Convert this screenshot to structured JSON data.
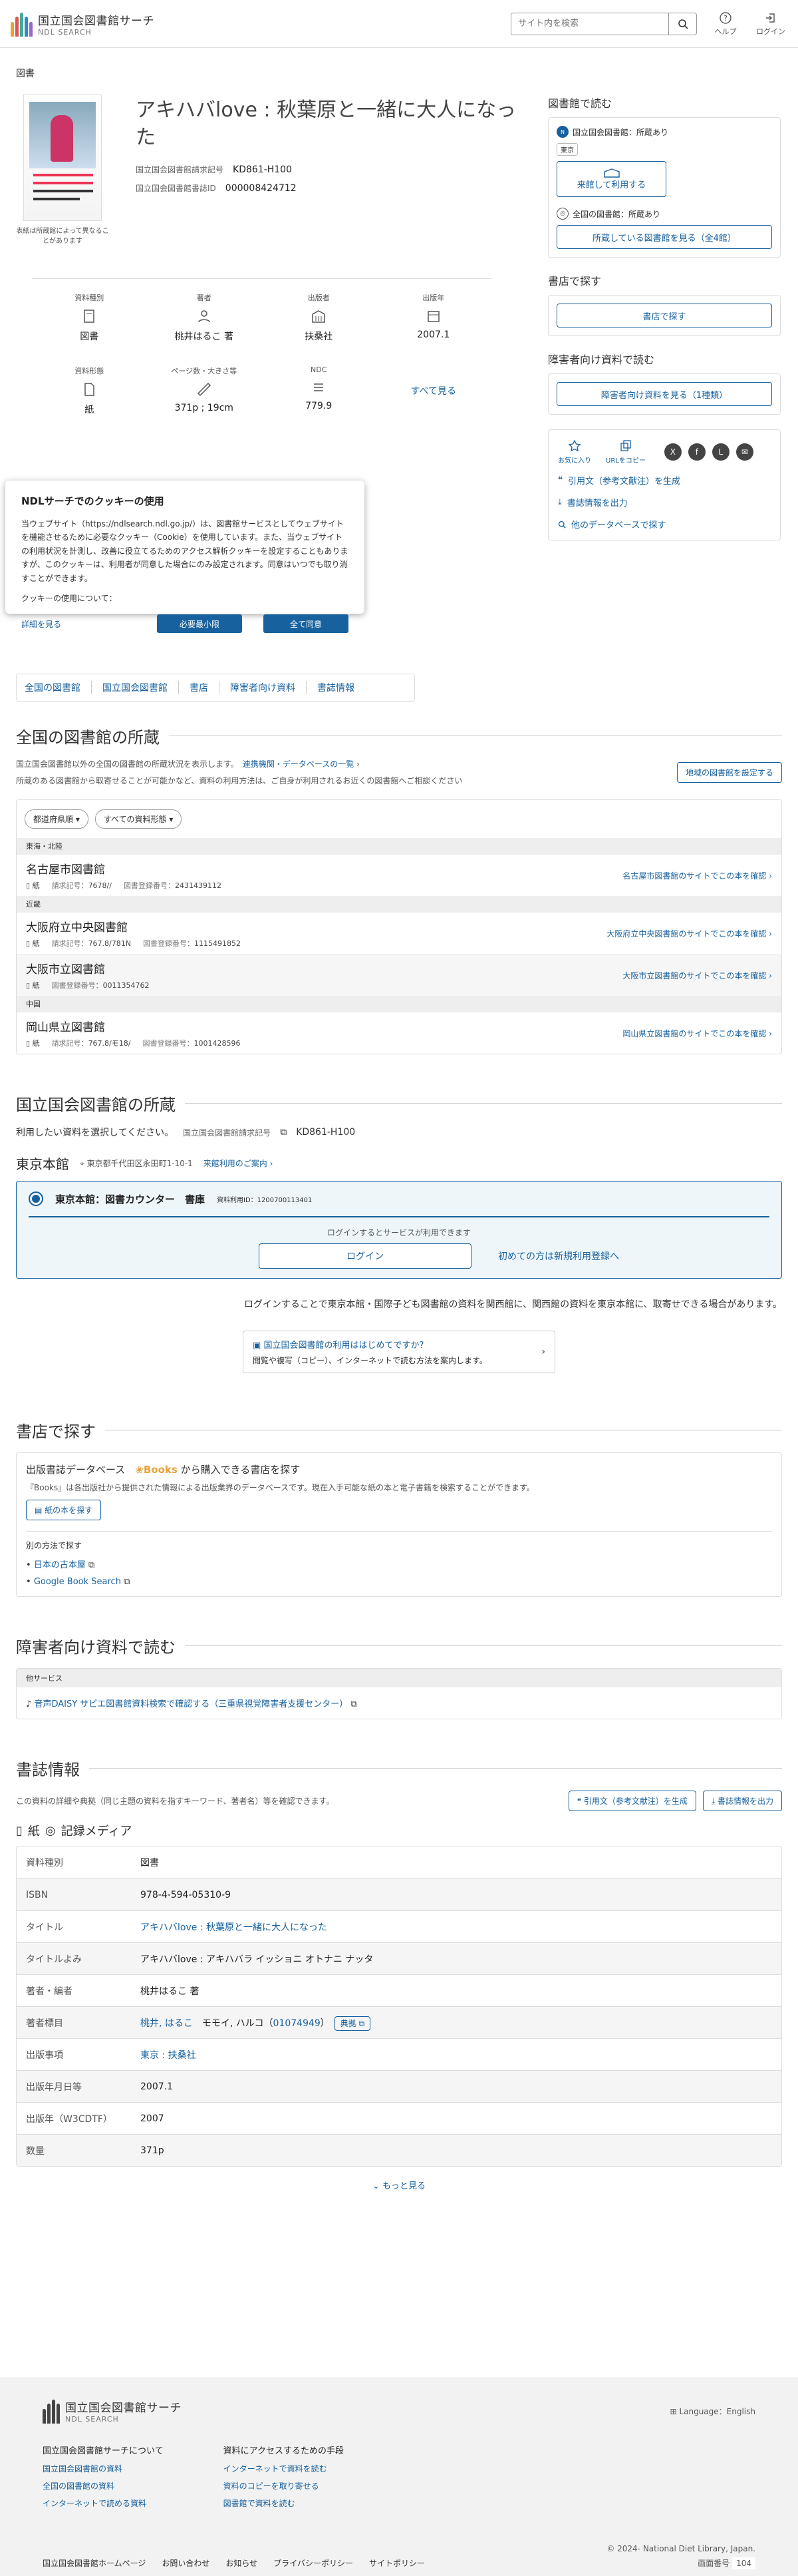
{
  "header": {
    "logo_main": "国立国会図書館サーチ",
    "logo_sub": "NDL SEARCH",
    "search_placeholder": "サイト内を検索",
    "help": "ヘルプ",
    "login": "ログイン"
  },
  "breadcrumb": "図書",
  "book": {
    "title": "アキハバlove : 秋葉原と一緒に大人になった",
    "call_label": "国立国会図書館請求記号",
    "call_value": "KD861-H100",
    "id_label": "国立国会図書館書誌ID",
    "id_value": "000008424712",
    "cover_note": "表紙は所蔵館によって異なることがあります"
  },
  "facts": [
    {
      "label": "資料種別",
      "value": "図書"
    },
    {
      "label": "著者",
      "value": "桃井はるこ 著"
    },
    {
      "label": "出版者",
      "value": "扶桑社"
    },
    {
      "label": "出版年",
      "value": "2007.1"
    },
    {
      "label": "資料形態",
      "value": "紙"
    },
    {
      "label": "ページ数・大きさ等",
      "value": "371p ; 19cm"
    },
    {
      "label": "NDC",
      "value": "779.9"
    }
  ],
  "see_all": "すべて見る",
  "right": {
    "read_title": "図書館で読む",
    "ndl_holding": "国立国会図書館：所蔵あり",
    "tokyo_tag": "東京",
    "visit_btn": "来館して利用する",
    "all_holding": "全国の図書館：所蔵あり",
    "all_btn": "所蔵している図書館を見る（全4館）",
    "store_title": "書店で探す",
    "store_btn": "書店で探す",
    "dis_title": "障害者向け資料で読む",
    "dis_btn": "障害者向け資料を見る（1種類）",
    "fav": "お気に入り",
    "url": "URLをコピー",
    "cite": "引用文（参考文献注）を生成",
    "export": "書誌情報を出力",
    "other_db": "他のデータベースで探す"
  },
  "cookie": {
    "title": "NDLサーチでのクッキーの使用",
    "body": "当ウェブサイト（https://ndlsearch.ndl.go.jp/）は、図書館サービスとしてウェブサイトを機能させるために必要なクッキー（Cookie）を使用しています。また、当ウェブサイトの利用状況を計測し、改善に役立てるためのアクセス解析クッキーを設定することもありますが、このクッキーは、利用者が同意した場合にのみ設定されます。同意はいつでも取り消すことができます。",
    "about": "クッキーの使用について：",
    "more": "詳細を見る",
    "min": "必要最小限",
    "all": "全て同意"
  },
  "anchors": [
    "全国の図書館",
    "国立国会図書館",
    "書店",
    "障害者向け資料",
    "書誌情報"
  ],
  "national": {
    "title": "全国の図書館の所蔵",
    "desc": "国立国会図書館以外の全国の図書館の所蔵状況を表示します。",
    "link": "連携機関・データベースの一覧",
    "desc2": "所蔵のある図書館から取寄せることが可能かなど、資料の利用方法は、ご自身が利用されるお近くの図書館へご相談ください",
    "region_btn": "地域の図書館を設定する",
    "filter1": "都道府県順",
    "filter2": "すべての資料形態",
    "rows": [
      {
        "region": "東海・北陸",
        "name": "名古屋市図書館",
        "form": "紙",
        "call_k": "請求記号：",
        "call_v": "7678//",
        "reg_k": "図書登録番号：",
        "reg_v": "2431439112",
        "link": "名古屋市図書館のサイトでこの本を確認"
      },
      {
        "region": "近畿",
        "name": "大阪府立中央図書館",
        "form": "紙",
        "call_k": "請求記号：",
        "call_v": "767.8/781N",
        "reg_k": "図書登録番号：",
        "reg_v": "1115491852",
        "link": "大阪府立中央図書館のサイトでこの本を確認"
      },
      {
        "region": "",
        "name": "大阪市立図書館",
        "form": "紙",
        "call_k": "",
        "call_v": "",
        "reg_k": "図書登録番号：",
        "reg_v": "0011354762",
        "link": "大阪市立図書館のサイトでこの本を確認"
      },
      {
        "region": "中国",
        "name": "岡山県立図書館",
        "form": "紙",
        "call_k": "請求記号：",
        "call_v": "767.8/モ18/",
        "reg_k": "図書登録番号：",
        "reg_v": "1001428596",
        "link": "岡山県立図書館のサイトでこの本を確認"
      }
    ]
  },
  "ndl": {
    "title": "国立国会図書館の所蔵",
    "pick": "利用したい資料を選択してください。",
    "call_k": "国立国会図書館請求記号",
    "call_v": "KD861-H100",
    "branch": "東京本館",
    "addr": "東京都千代田区永田町1-10-1",
    "guide_link": "来館利用のご案内",
    "counter": "東京本館：図書カウンター　書庫",
    "item_id": "資料利用ID：1200700113401",
    "login_note": "ログインするとサービスが利用できます",
    "login_btn": "ログイン",
    "register": "初めての方は新規利用登録へ",
    "note": "ログインすることで東京本館・国際子ども図書館の資料を関西館に、関西館の資料を東京本館に、取寄せできる場合があります。",
    "guide_t": "国立国会図書館の利用ははじめてですか？",
    "guide_s": "閲覧や複写（コピー）、インターネットで読む方法を案内します。"
  },
  "store": {
    "title": "書店で探す",
    "head1": "出版書誌データベース",
    "books": "Books",
    "head2": "から購入できる書店を探す",
    "desc": "『Books』は各出版社から提供された情報による出版業界のデータベースです。現在入手可能な紙の本と電子書籍を検索することができます。",
    "btn": "紙の本を探す",
    "other": "別の方法で探す",
    "links": [
      "日本の古本屋",
      "Google Book Search"
    ]
  },
  "dis": {
    "title": "障害者向け資料で読む",
    "cat": "他サービス",
    "link": "音声DAISY サピエ図書館資料検索で確認する（三重県視覚障害者支援センター）"
  },
  "biblio": {
    "title": "書誌情報",
    "desc": "この資料の詳細や典拠（同じ主題の資料を指すキーワード、著者名）等を確認できます。",
    "cite": "引用文（参考文献注）を生成",
    "export": "書誌情報を出力",
    "media1": "紙",
    "media2": "記録メディア",
    "rows": [
      {
        "k": "資料種別",
        "v": "図書"
      },
      {
        "k": "ISBN",
        "v": "978-4-594-05310-9"
      },
      {
        "k": "タイトル",
        "v": "アキハバlove : 秋葉原と一緒に大人になった"
      },
      {
        "k": "タイトルよみ",
        "v": "アキハバlove : アキハバラ イッショニ オトナニ ナッタ"
      },
      {
        "k": "著者・編者",
        "v": "桃井はるこ 著"
      },
      {
        "k": "著者標目",
        "v": "桃井, はるこ",
        "v2": "モモイ, ハルコ",
        "v3": "01074949",
        "v4": "典拠"
      },
      {
        "k": "出版事項",
        "v": "東京 : 扶桑社"
      },
      {
        "k": "出版年月日等",
        "v": "2007.1"
      },
      {
        "k": "出版年（W3CDTF）",
        "v": "2007"
      },
      {
        "k": "数量",
        "v": "371p"
      }
    ],
    "more": "もっと見る"
  },
  "footer": {
    "logo_main": "国立国会図書館サーチ",
    "logo_sub": "NDL SEARCH",
    "lang": "Language：English",
    "col1_t": "国立国会図書館サーチについて",
    "col1": [
      "国立国会図書館の資料",
      "全国の図書館の資料",
      "インターネットで読める資料"
    ],
    "col2_t": "資料にアクセスするための手段",
    "col2": [
      "インターネットで資料を読む",
      "資料のコピーを取り寄せる",
      "図書館で資料を読む"
    ],
    "bottom": [
      "国立国会図書館ホームページ",
      "お問い合わせ",
      "お知らせ",
      "プライバシーポリシー",
      "サイトポリシー"
    ],
    "copy": "© 2024- National Diet Library, Japan.",
    "screen_k": "画面番号",
    "screen_v": "104"
  }
}
